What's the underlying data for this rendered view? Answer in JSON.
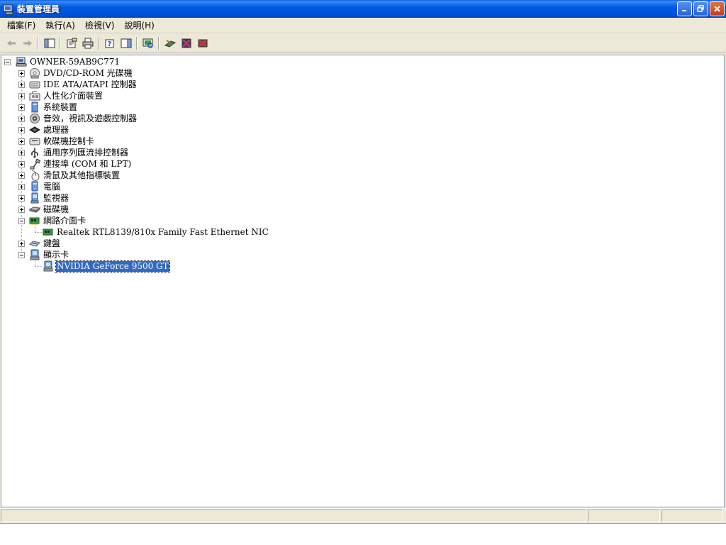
{
  "window": {
    "title": "裝置管理員"
  },
  "menu": [
    {
      "label": "檔案(F)"
    },
    {
      "label": "執行(A)"
    },
    {
      "label": "檢視(V)"
    },
    {
      "label": "說明(H)"
    }
  ],
  "toolbar": {
    "buttons": [
      "back",
      "forward",
      "console-tree",
      "properties",
      "print",
      "help",
      "show-hide",
      "scan-hardware",
      "update-driver",
      "disable-device",
      "uninstall-device"
    ]
  },
  "tree": {
    "root": {
      "label": "OWNER-59AB9C771"
    },
    "categories": [
      {
        "label": "DVD/CD-ROM 光碟機",
        "icon": "cdrom-icon",
        "expanded": false
      },
      {
        "label": "IDE ATA/ATAPI 控制器",
        "icon": "ide-controller-icon",
        "expanded": false
      },
      {
        "label": "人性化介面裝置",
        "icon": "hid-icon",
        "expanded": false
      },
      {
        "label": "系統裝置",
        "icon": "system-device-icon",
        "expanded": false
      },
      {
        "label": "音效，視訊及遊戲控制器",
        "icon": "sound-icon",
        "expanded": false
      },
      {
        "label": "處理器",
        "icon": "processor-icon",
        "expanded": false
      },
      {
        "label": "軟碟機控制卡",
        "icon": "floppy-controller-icon",
        "expanded": false
      },
      {
        "label": "通用序列匯流排控制器",
        "icon": "usb-icon",
        "expanded": false
      },
      {
        "label": "連接埠 (COM 和 LPT)",
        "icon": "port-icon",
        "expanded": false
      },
      {
        "label": "滑鼠及其他指標裝置",
        "icon": "mouse-icon",
        "expanded": false
      },
      {
        "label": "電腦",
        "icon": "computer-icon",
        "expanded": false
      },
      {
        "label": "監視器",
        "icon": "monitor-icon",
        "expanded": false
      },
      {
        "label": "磁碟機",
        "icon": "disk-drive-icon",
        "expanded": false
      },
      {
        "label": "網路介面卡",
        "icon": "network-adapter-icon",
        "expanded": true,
        "children": [
          {
            "label": "Realtek RTL8139/810x Family Fast Ethernet NIC",
            "icon": "network-card-icon",
            "selected": false
          }
        ]
      },
      {
        "label": "鍵盤",
        "icon": "keyboard-icon",
        "expanded": false
      },
      {
        "label": "顯示卡",
        "icon": "display-adapter-icon",
        "expanded": true,
        "children": [
          {
            "label": "NVIDIA GeForce 9500 GT",
            "icon": "display-card-icon",
            "selected": true
          }
        ]
      }
    ]
  }
}
